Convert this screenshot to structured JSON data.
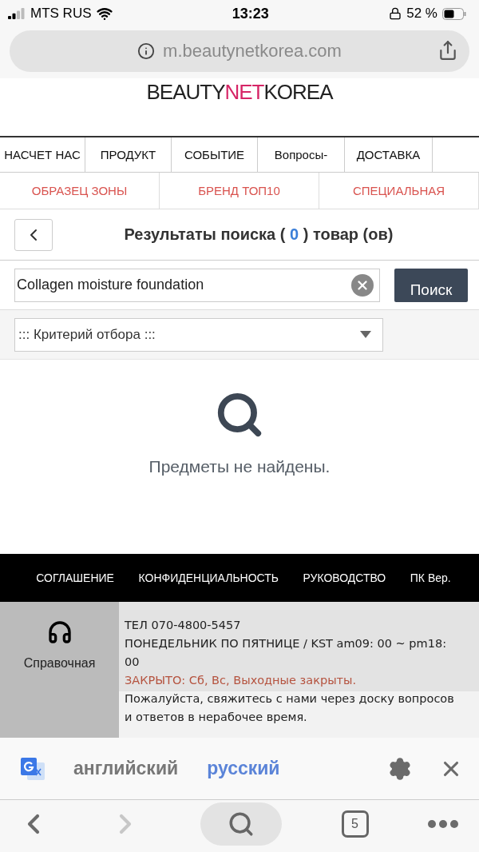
{
  "status_bar": {
    "carrier": "MTS RUS",
    "time": "13:23",
    "battery": "52 %"
  },
  "address_bar": {
    "url": "m.beautynetkorea.com"
  },
  "logo": {
    "parts": [
      "BEAUTY",
      "NET",
      "KOREA"
    ]
  },
  "nav": [
    "НАСЧЕТ НАС",
    "ПРОДУКТ",
    "СОБЫТИЕ",
    "Вопросы-",
    "ДОСТАВКА"
  ],
  "subnav": [
    "ОБРАЗЕЦ ЗОНЫ",
    "БРЕНД ТОП10",
    "СПЕЦИАЛЬНАЯ"
  ],
  "results": {
    "prefix": "Результаты поиска (",
    "count": "0",
    "suffix": ") товар (ов)"
  },
  "search": {
    "value": "Collagen moisture foundation",
    "button": "Поиск"
  },
  "filter": {
    "value": "::: Критерий отбора :::"
  },
  "empty_message": "Предметы не найдены.",
  "footer_links": [
    "СОГЛАШЕНИЕ",
    "КОНФИДЕНЦИАЛЬНОСТЬ",
    "РУКОВОДСТВО",
    "ПК Вер."
  ],
  "help": {
    "label": "Справочная",
    "phone": "ТЕЛ 070-4800-5457",
    "hours": "ПОНЕДЕЛЬНИК ПО ПЯТНИЦЕ / KST am09: 00 ~ pm18: 00",
    "closed": "ЗАКРЫТО: Сб, Вс, Выходные закрыты.",
    "note": "Пожалуйста, свяжитесь с нами через доску вопросов и ответов в нерабочее время."
  },
  "translate_bar": {
    "languages": [
      {
        "label": "английский",
        "selected": false
      },
      {
        "label": "русский",
        "selected": true
      }
    ]
  },
  "toolbar": {
    "tabs_count": "5"
  }
}
